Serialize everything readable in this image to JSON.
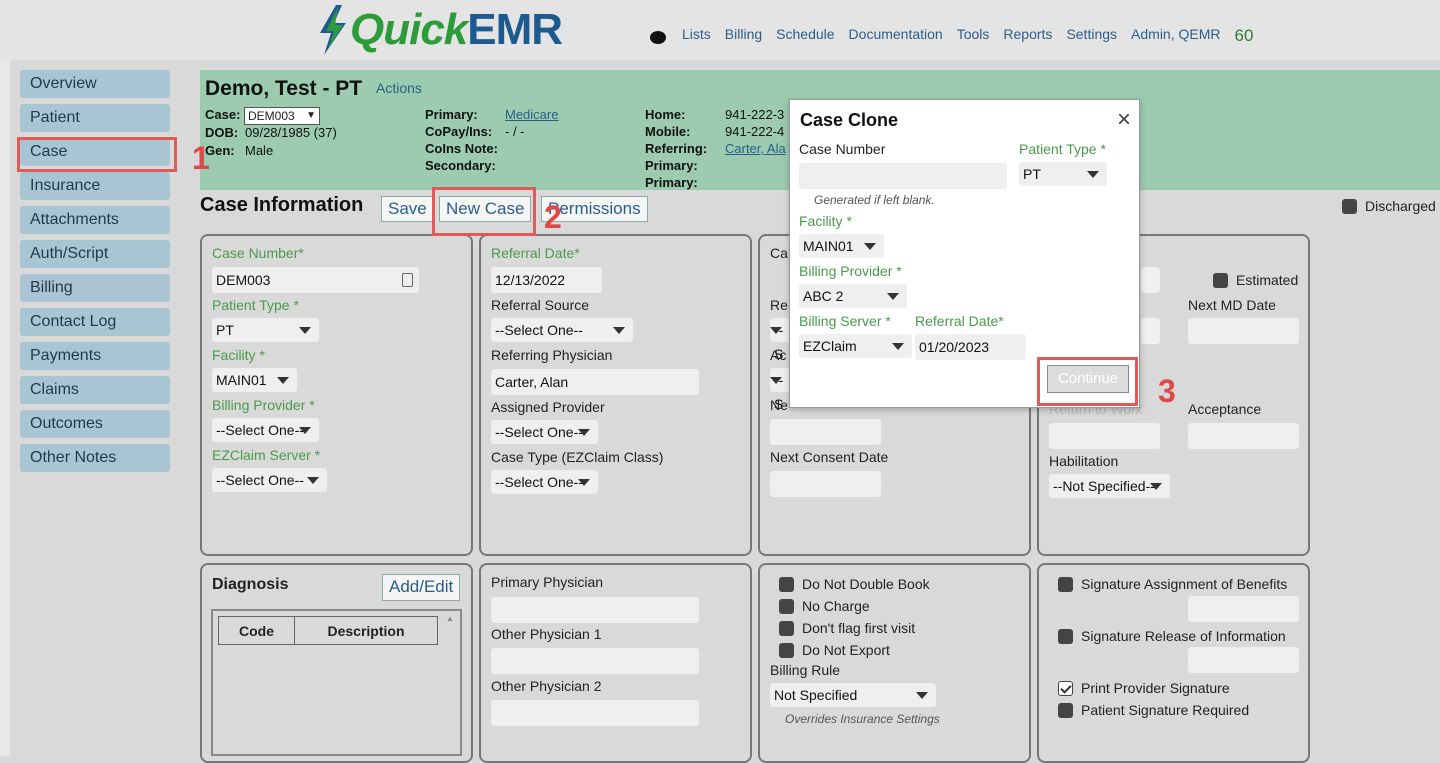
{
  "nav": {
    "logo_quick": "Quick",
    "logo_emr": "EMR",
    "items": [
      "Lists",
      "Billing",
      "Schedule",
      "Documentation",
      "Tools",
      "Reports",
      "Settings",
      "Admin, QEMR"
    ],
    "count": "60"
  },
  "sidebar": {
    "items": [
      "Overview",
      "Patient",
      "Case",
      "Insurance",
      "Attachments",
      "Auth/Script",
      "Billing",
      "Contact Log",
      "Payments",
      "Claims",
      "Outcomes",
      "Other Notes"
    ]
  },
  "header": {
    "title": "Demo, Test - PT",
    "actions": "Actions",
    "case_label": "Case:",
    "case_value": "DEM003",
    "dob_label": "DOB:",
    "dob_value": "09/28/1985 (37)",
    "gen_label": "Gen:",
    "gen_value": "Male",
    "primary_label": "Primary:",
    "primary_value": "Medicare",
    "copay_label": "CoPay/Ins:",
    "copay_value": "- / -",
    "coins_label": "CoIns Note:",
    "secondary_label": "Secondary:",
    "home_label": "Home:",
    "home_value": "941-222-3",
    "mobile_label": "Mobile:",
    "mobile_value": "941-222-4",
    "referring_label": "Referring:",
    "referring_value": "Carter, Ala",
    "primary2_label": "Primary:",
    "primary3_label": "Primary:"
  },
  "case_info": {
    "title": "Case Information",
    "save": "Save",
    "new_case": "New Case",
    "permissions": "Permissions",
    "discharged": "Discharged"
  },
  "panel1": {
    "case_number_label": "Case Number*",
    "case_number_value": "DEM003",
    "patient_type_label": "Patient Type *",
    "patient_type_value": "PT",
    "facility_label": "Facility *",
    "facility_value": "MAIN01",
    "billing_provider_label": "Billing Provider *",
    "billing_provider_value": "--Select One--",
    "ezclaim_label": "EZClaim Server *",
    "ezclaim_value": "--Select One--"
  },
  "panel2": {
    "referral_date_label": "Referral Date*",
    "referral_date_value": "12/13/2022",
    "referral_source_label": "Referral Source",
    "referral_source_value": "--Select One--",
    "referring_physician_label": "Referring Physician",
    "referring_physician_value": "Carter, Alan",
    "assigned_provider_label": "Assigned Provider",
    "assigned_provider_value": "--Select One--",
    "case_type_label": "Case Type (EZClaim Class)",
    "case_type_value": "--Select One--"
  },
  "panel3": {
    "ca_label": "Ca",
    "re_label": "Re",
    "re_value": "--S",
    "ac_label": "Ac",
    "ac_value": "--S",
    "ne_label": "Ne",
    "next_consent_label": "Next Consent Date"
  },
  "panel4": {
    "estimated": "Estimated",
    "next_md_label": "Next MD Date",
    "return_to_work_label": "Return to Work",
    "acceptance_label": "Acceptance",
    "habilitation_label": "Habilitation",
    "habilitation_value": "--Not Specified--"
  },
  "diagnosis": {
    "title": "Diagnosis",
    "add_edit": "Add/Edit",
    "columns": [
      "Code",
      "Description"
    ]
  },
  "physicians": {
    "primary_label": "Primary Physician",
    "other1_label": "Other Physician 1",
    "other2_label": "Other Physician 2"
  },
  "flags": {
    "do_not_double_book": "Do Not Double Book",
    "no_charge": "No Charge",
    "dont_flag_first_visit": "Don't flag first visit",
    "do_not_export": "Do Not Export",
    "billing_rule_label": "Billing Rule",
    "billing_rule_value": "Not Specified",
    "overrides_note": "Overrides Insurance Settings"
  },
  "signatures": {
    "assignment": "Signature Assignment of Benefits",
    "release": "Signature Release of Information",
    "print_provider": "Print Provider Signature",
    "patient_required": "Patient Signature Required"
  },
  "modal": {
    "title": "Case Clone",
    "close": "×",
    "case_number_label": "Case Number",
    "case_number_value": "",
    "generated_note": "Generated if left blank.",
    "patient_type_label": "Patient Type *",
    "patient_type_value": "PT",
    "facility_label": "Facility *",
    "facility_value": "MAIN01",
    "billing_provider_label": "Billing Provider *",
    "billing_provider_value": "ABC 2",
    "billing_server_label": "Billing Server *",
    "billing_server_value": "EZClaim",
    "referral_date_label": "Referral Date*",
    "referral_date_value": "01/20/2023",
    "continue": "Continue"
  },
  "callouts": [
    "1",
    "2",
    "3"
  ],
  "colors": {
    "header_band": "#9ccbb0",
    "sidebar_item": "#a9c4d2",
    "label_green": "#4a9a4a",
    "link_blue": "#2b5d8a",
    "callout_red": "#e05a5a"
  }
}
